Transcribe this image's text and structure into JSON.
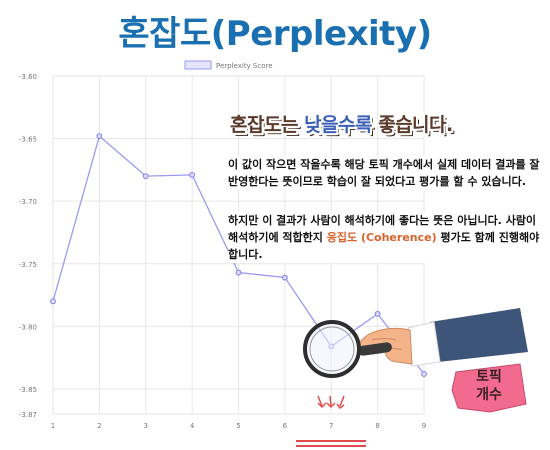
{
  "page": {
    "title": "혼잡도(Perplexity)"
  },
  "annotation": {
    "headline_a": "혼잡도",
    "headline_b": "는 ",
    "headline_c": "낮을수록",
    "headline_d": " 좋습니다.",
    "para1": " 이 값이 작으면 작을수록 해당 토픽 개수에서 실제 데이터 결과를 잘 반영한다는 뜻이므로 학습이 잘 되었다고 평가를 할 수 있습니다.",
    "para2_a": " 하지만 이 결과가 사람이 해석하기에 좋다는 뜻은 아닙니다.  사람이 해석하기에 적합한지 ",
    "para2_b": "응집도 (Coherence)",
    "para2_c": " 평가도 함께 진행해야 합니다.",
    "badge_line1": "토픽",
    "badge_line2": "개수"
  },
  "colors": {
    "title": "#1a6fb0",
    "line": "#9a9af5",
    "highlight": "#d9622b",
    "badge": "#f26a8d"
  },
  "icons": {
    "magnifier": "magnifier-icon",
    "hand": "hand-icon",
    "arrows": "down-arrow-icon"
  },
  "chart_data": {
    "type": "line",
    "x": [
      1,
      2,
      3,
      4,
      5,
      6,
      7,
      8,
      9
    ],
    "series": [
      {
        "name": "Perplexity Score",
        "values": [
          -3.78,
          -3.648,
          -3.68,
          -3.679,
          -3.757,
          -3.761,
          -3.816,
          -3.79,
          -3.838
        ]
      }
    ],
    "ylim": [
      -3.87,
      -3.6
    ],
    "yticks": [
      "-3.60",
      "-3.65",
      "-3.70",
      "-3.75",
      "-3.80",
      "-3.85",
      "-3.87"
    ],
    "ytick_values": [
      -3.6,
      -3.65,
      -3.7,
      -3.75,
      -3.8,
      -3.85,
      -3.87
    ],
    "xticks": [
      "1",
      "2",
      "3",
      "4",
      "5",
      "6",
      "7",
      "8",
      "9"
    ],
    "legend": "top",
    "grid": true
  }
}
